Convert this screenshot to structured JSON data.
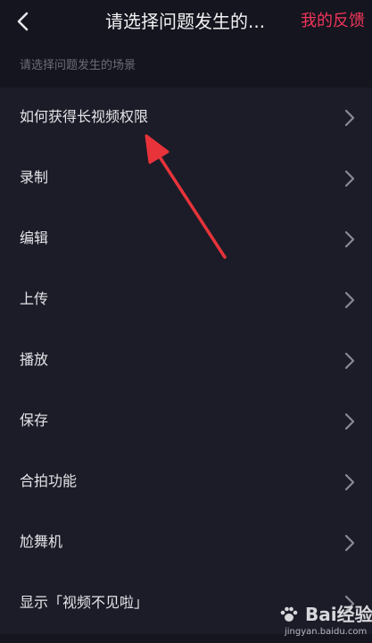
{
  "header": {
    "title": "请选择问题发生的...",
    "feedback_label": "我的反馈"
  },
  "section": {
    "hint": "请选择问题发生的场景"
  },
  "items": [
    {
      "label": "如何获得长视频权限"
    },
    {
      "label": "录制"
    },
    {
      "label": "编辑"
    },
    {
      "label": "上传"
    },
    {
      "label": "播放"
    },
    {
      "label": "保存"
    },
    {
      "label": "合拍功能"
    },
    {
      "label": "尬舞机"
    },
    {
      "label": "显示「视频不见啦」"
    }
  ],
  "watermark": {
    "brand": "Bai经验",
    "url": "jingyan.baidu.com"
  },
  "colors": {
    "background": "#15151f",
    "list_background": "#1c1c28",
    "accent": "#f2355a",
    "annotation_arrow": "#e8333a"
  },
  "icons": {
    "back": "back-arrow-icon",
    "row": "chevron-right-icon"
  }
}
